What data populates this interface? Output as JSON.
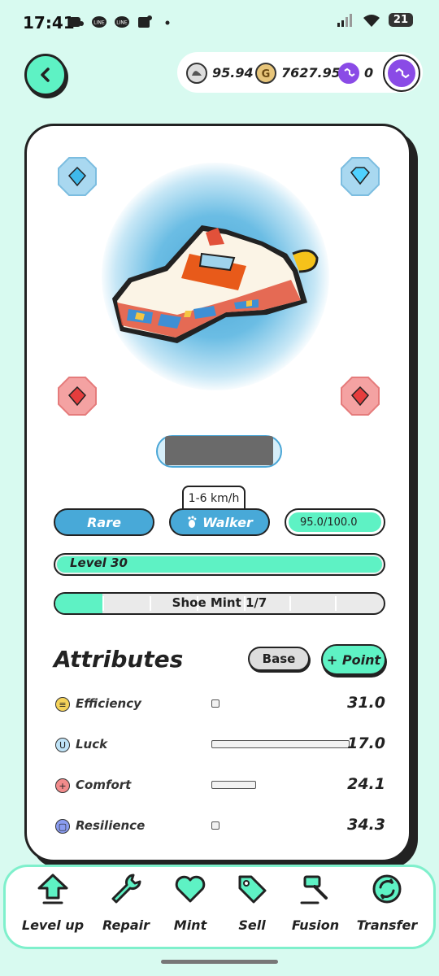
{
  "status_bar": {
    "time": "17:41",
    "battery": "21"
  },
  "wallet": {
    "gst": "95.94",
    "gmt": "7627.95",
    "matic": "0"
  },
  "sneaker": {
    "quality": "Rare",
    "type": "Walker",
    "speed_range": "1-6 km/h",
    "durability": "95.0/100.0",
    "level": "Level 30",
    "level_progress": 1.0,
    "mint": "Shoe Mint 1/7",
    "mint_progress": 0.142,
    "colors": {
      "rare": "#48a9d8",
      "accent": "#5ef2c4"
    }
  },
  "attributes": {
    "title": "Attributes",
    "base_label": "Base",
    "point_label": "+ Point",
    "items": [
      {
        "icon": "efficiency-icon",
        "label": "Efficiency",
        "value": "31.0",
        "bonus_fraction": 0.0
      },
      {
        "icon": "luck-icon",
        "label": "Luck",
        "value": "17.0",
        "bonus_fraction": 1.0
      },
      {
        "icon": "comfort-icon",
        "label": "Comfort",
        "value": "24.1",
        "bonus_fraction": 0.32
      },
      {
        "icon": "resilience-icon",
        "label": "Resilience",
        "value": "34.3",
        "bonus_fraction": 0.0
      }
    ]
  },
  "nav": {
    "items": [
      {
        "label": "Level up",
        "icon": "level-up-icon"
      },
      {
        "label": "Repair",
        "icon": "wrench-icon"
      },
      {
        "label": "Mint",
        "icon": "heart-icon"
      },
      {
        "label": "Sell",
        "icon": "tag-icon"
      },
      {
        "label": "Fusion",
        "icon": "hammer-icon"
      },
      {
        "label": "Transfer",
        "icon": "transfer-icon"
      }
    ]
  }
}
